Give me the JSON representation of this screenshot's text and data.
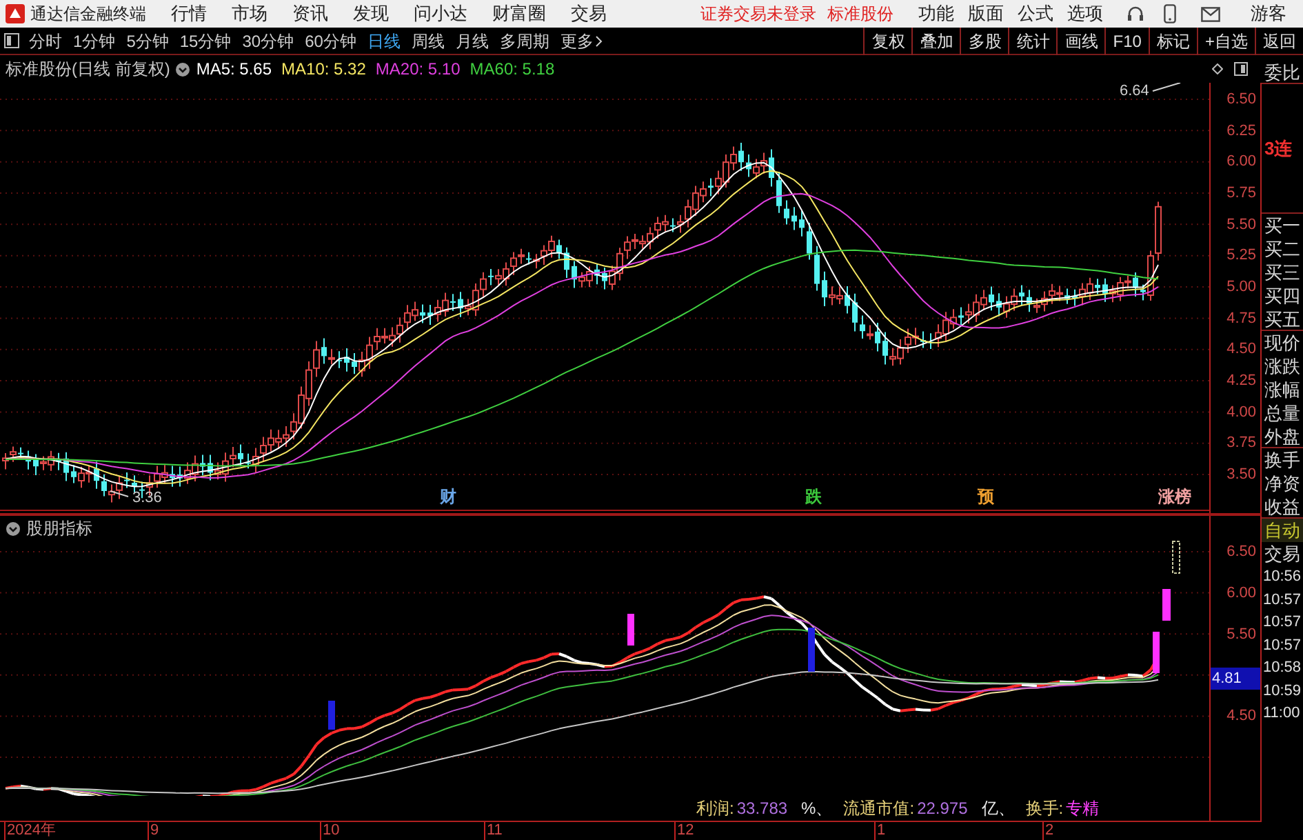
{
  "app": {
    "title": "通达信金融终端"
  },
  "menu": [
    "行情",
    "市场",
    "资讯",
    "发现",
    "问小达",
    "财富圈",
    "交易"
  ],
  "login_status": "证券交易未登录",
  "stock_name": "标准股份",
  "tools": [
    "功能",
    "版面",
    "公式",
    "选项"
  ],
  "user": "游客",
  "periods": [
    {
      "label": "分时",
      "selected": false
    },
    {
      "label": "1分钟",
      "selected": false
    },
    {
      "label": "5分钟",
      "selected": false
    },
    {
      "label": "15分钟",
      "selected": false
    },
    {
      "label": "30分钟",
      "selected": false
    },
    {
      "label": "60分钟",
      "selected": false
    },
    {
      "label": "日线",
      "selected": true
    },
    {
      "label": "周线",
      "selected": false
    },
    {
      "label": "月线",
      "selected": false
    },
    {
      "label": "多周期",
      "selected": false
    },
    {
      "label": "更多",
      "selected": false
    }
  ],
  "actions": [
    "复权",
    "叠加",
    "多股",
    "统计",
    "画线",
    "F10",
    "标记",
    "+自选",
    "返回"
  ],
  "chart": {
    "title": "标准股份(日线 前复权)",
    "ma": [
      {
        "label": "MA5: 5.65",
        "color": "#ffffff"
      },
      {
        "label": "MA10: 5.32",
        "color": "#f5e663"
      },
      {
        "label": "MA20: 5.10",
        "color": "#e040e0"
      },
      {
        "label": "MA60: 5.18",
        "color": "#40d040"
      }
    ],
    "yticks": [
      "6.50",
      "6.25",
      "6.00",
      "5.75",
      "5.50",
      "5.25",
      "5.00",
      "4.75",
      "4.50",
      "4.25",
      "4.00",
      "3.75",
      "3.50"
    ],
    "low_label": "3.36",
    "high_label": "6.64",
    "signals": [
      {
        "text": "财",
        "color": "#6aa6e8"
      },
      {
        "text": "跌",
        "color": "#3cc83c"
      },
      {
        "text": "预",
        "color": "#f0a030"
      },
      {
        "text": "涨榜",
        "color": "#f0a0a0"
      }
    ]
  },
  "indicator": {
    "title": "股朋指标",
    "yticks": [
      "6.50",
      "6.00",
      "5.50",
      "4.50"
    ],
    "current": "4.81",
    "stats": [
      {
        "label": "利润:",
        "value": "33.783",
        "unit": "%、"
      },
      {
        "label": "流通市值:",
        "value": "22.975",
        "unit": "亿、"
      },
      {
        "label": "换手:",
        "value": "专精"
      }
    ]
  },
  "x_axis": [
    "2024年",
    "9",
    "10",
    "11",
    "12",
    "1",
    "2"
  ],
  "quote_panel": [
    {
      "text": "委比",
      "kind": "label"
    },
    {
      "text": "3连",
      "kind": "streak"
    },
    {
      "text": "买一",
      "kind": "label"
    },
    {
      "text": "买二",
      "kind": "label"
    },
    {
      "text": "买三",
      "kind": "label"
    },
    {
      "text": "买四",
      "kind": "label"
    },
    {
      "text": "买五",
      "kind": "label"
    },
    {
      "text": "现价",
      "kind": "label"
    },
    {
      "text": "涨跌",
      "kind": "label"
    },
    {
      "text": "涨幅",
      "kind": "label"
    },
    {
      "text": "总量",
      "kind": "label"
    },
    {
      "text": "外盘",
      "kind": "label"
    },
    {
      "text": "换手",
      "kind": "label"
    },
    {
      "text": "净资",
      "kind": "label"
    },
    {
      "text": "收益",
      "kind": "label"
    },
    {
      "text": "自动",
      "kind": "auto"
    },
    {
      "text": "交易",
      "kind": "label"
    },
    {
      "text": "10:56",
      "kind": "time"
    },
    {
      "text": "10:57",
      "kind": "time"
    },
    {
      "text": "10:57",
      "kind": "time"
    },
    {
      "text": "10:57",
      "kind": "time"
    },
    {
      "text": "10:58",
      "kind": "time"
    },
    {
      "text": "10:59",
      "kind": "time"
    },
    {
      "text": "11:00",
      "kind": "time"
    }
  ]
}
